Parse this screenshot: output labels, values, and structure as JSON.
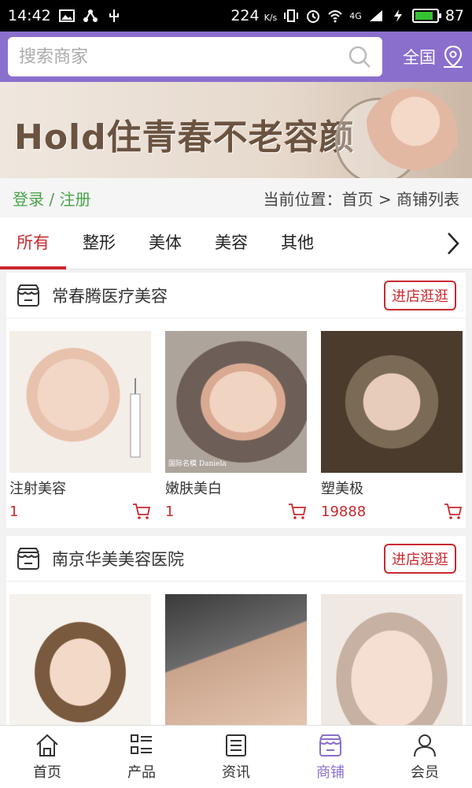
{
  "status": {
    "time": "14:42",
    "speed": "224",
    "speed_unit": "K/s",
    "network": "4G",
    "battery": "87"
  },
  "search": {
    "placeholder": "搜索商家",
    "region": "全国"
  },
  "banner": {
    "slogan": "Hold住青春不老容颜"
  },
  "location": {
    "login_text": "登录 / 注册",
    "breadcrumb": "当前位置：首页 > 商铺列表"
  },
  "tabs": [
    {
      "label": "所有",
      "active": true
    },
    {
      "label": "整形"
    },
    {
      "label": "美体"
    },
    {
      "label": "美容"
    },
    {
      "label": "其他"
    }
  ],
  "shops": [
    {
      "name": "常春腾医疗美容",
      "button": "进店逛逛",
      "products": [
        {
          "name": "注射美容",
          "price": "1"
        },
        {
          "name": "嫩肤美白",
          "price": "1",
          "watermark": "国际名模 Daniela"
        },
        {
          "name": "塑美极",
          "price": "19888"
        }
      ]
    },
    {
      "name": "南京华美美容医院",
      "button": "进店逛逛",
      "products": [
        {
          "name": "",
          "price": ""
        },
        {
          "name": "",
          "price": ""
        },
        {
          "name": "",
          "price": ""
        }
      ]
    }
  ],
  "tabbar": [
    {
      "label": "首页",
      "icon": "home-icon"
    },
    {
      "label": "产品",
      "icon": "list-icon"
    },
    {
      "label": "资讯",
      "icon": "news-icon"
    },
    {
      "label": "商铺",
      "icon": "shop-icon",
      "active": true
    },
    {
      "label": "会员",
      "icon": "user-icon"
    }
  ],
  "colors": {
    "primary": "#8b6fcd",
    "accent": "#c9292e",
    "login": "#4aa34a"
  }
}
